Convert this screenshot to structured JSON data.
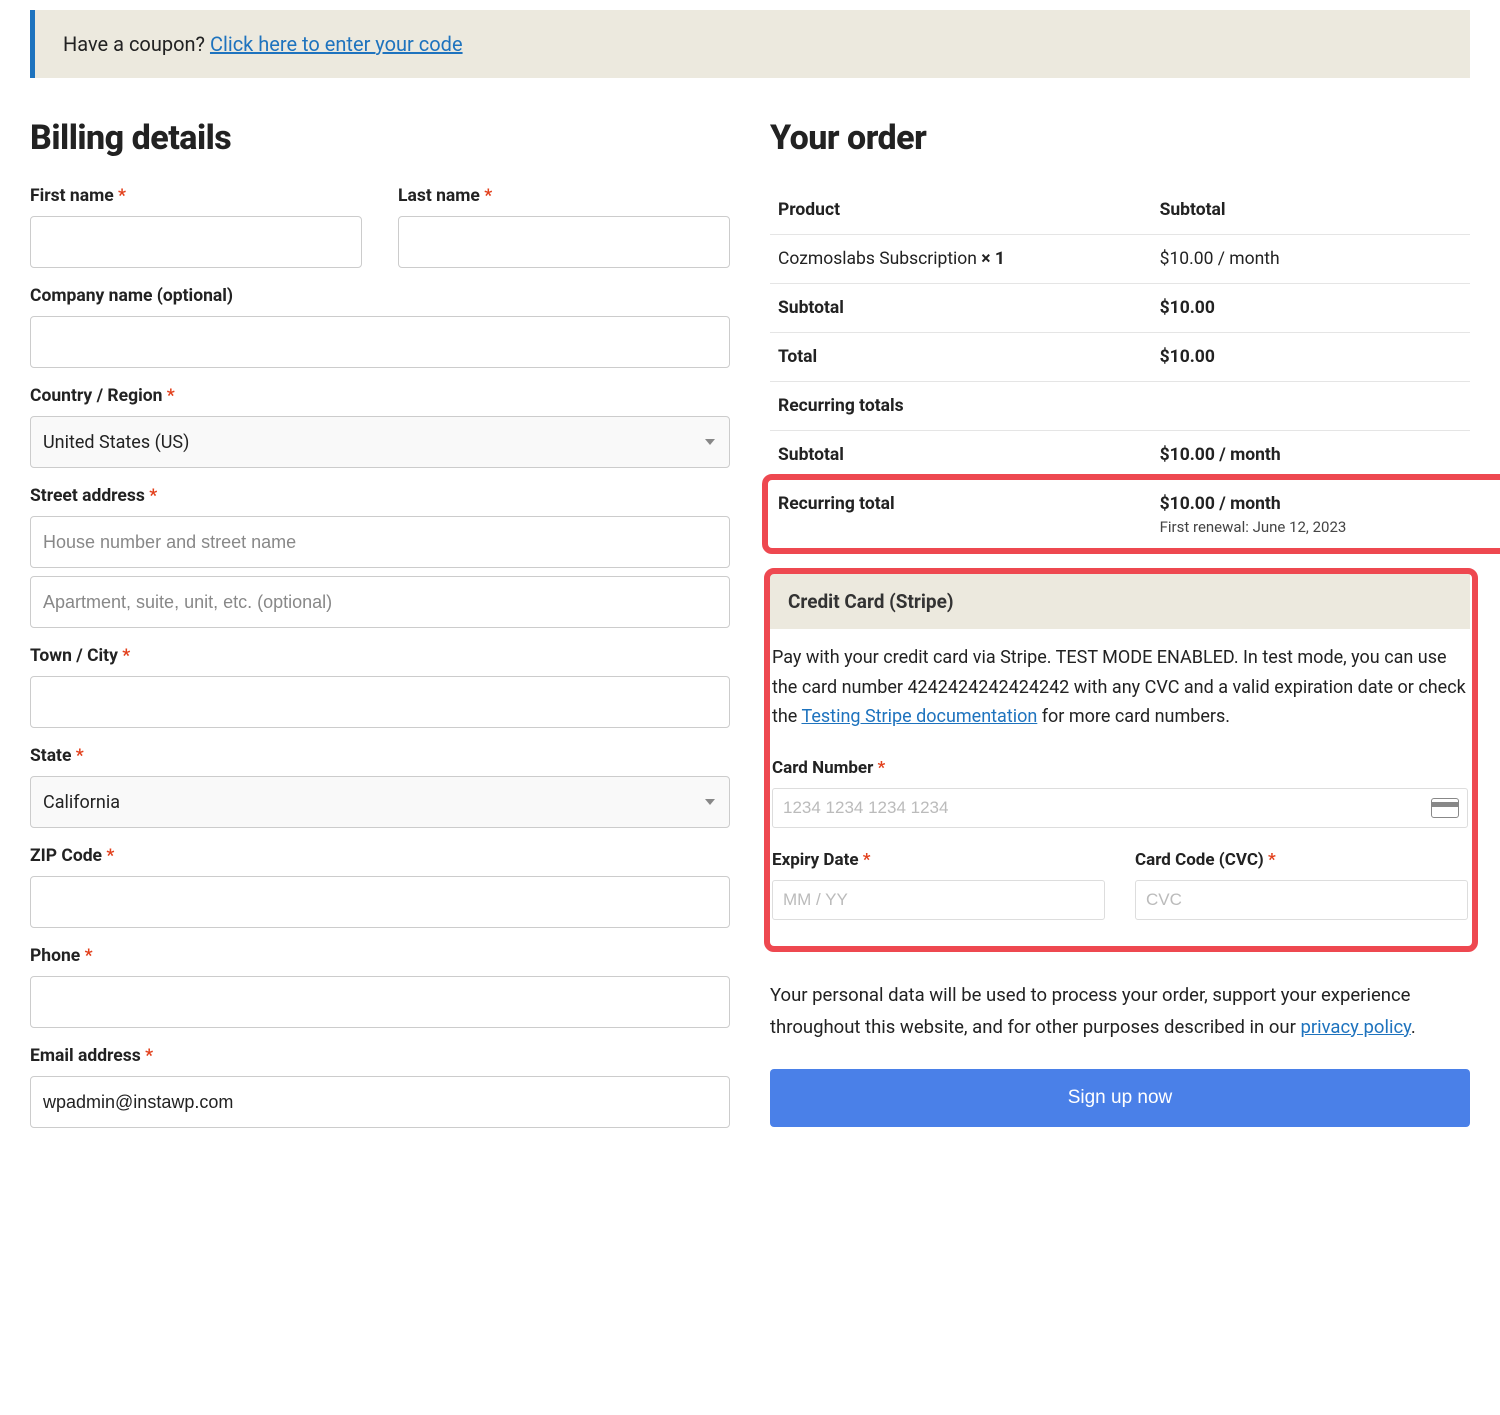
{
  "coupon": {
    "prompt": "Have a coupon? ",
    "link": "Click here to enter your code"
  },
  "billing": {
    "title": "Billing details",
    "first_name_label": "First name",
    "last_name_label": "Last name",
    "company_label": "Company name (optional)",
    "country_label": "Country / Region",
    "country_value": "United States (US)",
    "street_label": "Street address",
    "street_placeholder": "House number and street name",
    "street2_placeholder": "Apartment, suite, unit, etc. (optional)",
    "city_label": "Town / City",
    "state_label": "State",
    "state_value": "California",
    "zip_label": "ZIP Code",
    "phone_label": "Phone",
    "email_label": "Email address",
    "email_value": "wpadmin@instawp.com"
  },
  "order": {
    "title": "Your order",
    "product_header": "Product",
    "subtotal_header": "Subtotal",
    "product_name": "Cozmoslabs Subscription ",
    "product_qty": " × 1",
    "product_price": "$10.00 / month",
    "subtotal_label": "Subtotal",
    "subtotal_value": "$10.00",
    "total_label": "Total",
    "total_value": "$10.00",
    "recurring_header": "Recurring totals",
    "recurring_subtotal_label": "Subtotal",
    "recurring_subtotal_value": "$10.00 / month",
    "recurring_total_label": "Recurring total",
    "recurring_total_value": "$10.00 / month",
    "first_renewal": "First renewal: June 12, 2023"
  },
  "payment": {
    "title": "Credit Card (Stripe)",
    "desc_part1": "Pay with your credit card via Stripe. TEST MODE ENABLED. In test mode, you can use the card number 4242424242424242 with any CVC and a valid expiration date or check the ",
    "desc_link": "Testing Stripe documentation",
    "desc_part2": " for more card numbers.",
    "card_number_label": "Card Number",
    "card_number_placeholder": "1234 1234 1234 1234",
    "expiry_label": "Expiry Date",
    "expiry_placeholder": "MM / YY",
    "cvc_label": "Card Code (CVC)",
    "cvc_placeholder": "CVC"
  },
  "privacy": {
    "text_part1": "Your personal data will be used to process your order, support your experience throughout this website, and for other purposes described in our ",
    "link": "privacy policy",
    "text_part2": "."
  },
  "signup_label": "Sign up now",
  "required_mark": " *"
}
